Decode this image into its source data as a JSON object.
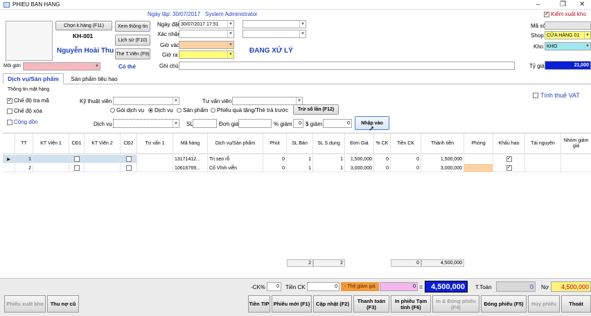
{
  "window": {
    "title": "PHIEU BAN HANG",
    "minimize": "–",
    "restore": "❐",
    "close": "✕"
  },
  "header": {
    "created_label": "Ngày lập: 30/07/2017",
    "user": "System Administrator",
    "status": "ĐANG XỬ LÝ",
    "kiem_xuat_kho": "Kiểm xuất kho"
  },
  "customer": {
    "choose_button": "Chọn k.hàng (F11)",
    "code": "KH-001",
    "name": "Nguyễn Hoài Thu",
    "info_button": "Xem thông tin",
    "history_button": "Lịch sử (F10)",
    "card_button": "Thẻ T.Viên (F9)",
    "has_card": "Có thẻ"
  },
  "booking": {
    "date_label": "Ngày đặt",
    "date_value": "30/07/2017 17:51",
    "confirm_label": "Xác nhận",
    "in_label": "Giờ vào",
    "out_label": "Giờ ra",
    "note_label": "Ghi chú"
  },
  "right_panel": {
    "so_label": "Mã số",
    "shop_label": "Shop",
    "shop_value": "CỬA HÀNG 01",
    "kho_label": "Kho",
    "kho_value": "KHO",
    "rate_label": "Tỷ giá",
    "rate_value": "21,000"
  },
  "referrer": {
    "label": "Môi giới"
  },
  "tabs": [
    {
      "label": "Dịch vụ/Sản phẩm"
    },
    {
      "label": "Sản phẩm tiêu hao"
    }
  ],
  "sale_info": {
    "section": "Thông tin mặt hàng",
    "che_do_tra_ma": "Chế độ tra mã",
    "che_do_xoa": "Chế độ xóa",
    "cong_don": "Cộng dồn",
    "ky_thuat_vien": "Kỹ thuật viên",
    "tu_van_vien": "Tư vấn viên",
    "tinh_thue_vat": "Tính thuế VAT",
    "radios": [
      "Gói dịch vụ",
      "Dịch vụ",
      "Sản phẩm",
      "Phiếu quà tặng/Thẻ trả trước"
    ],
    "tru_so_lan": "Trừ số lần (F12)",
    "dich_vu_label": "Dịch vụ",
    "sl_label": "SL",
    "don_gia_label": "Đơn giá",
    "pct_giam_label": "% giảm",
    "pct_giam_value": "0",
    "usd_giam_label": "$ giảm",
    "usd_giam_value": "0",
    "nhap_vao": "Nhập vào"
  },
  "grid": {
    "columns": [
      "TT",
      "KT Viên 1",
      "CĐ1",
      "KT Viên 2",
      "CĐ2",
      "Tư vấn 1",
      "Mã hàng",
      "Dịch vụ/Sản phẩm",
      "Phút",
      "SL Bán",
      "SL S.dụng",
      "Đơn Giá",
      "% CK",
      "Tiền CK",
      "Thành tiền",
      "Phòng",
      "Khấu hao",
      "Tài nguyên",
      "Nhóm giảm giá"
    ],
    "rows": [
      {
        "tt": "1",
        "ma_hang": "13171412...",
        "ten": "Trị sẹo rỗ",
        "phut": "0",
        "sl_ban": "1",
        "sl_sd": "1",
        "don_gia": "1,500,000",
        "ck": "0",
        "tien_ck": "0",
        "thanh_tien": "1,500,000"
      },
      {
        "tt": "2",
        "ma_hang": "10616769...",
        "ten": "Cố Vĩnh viễn",
        "phut": "0",
        "sl_ban": "1",
        "sl_sd": "1",
        "don_gia": "3,000,000",
        "ck": "0",
        "tien_ck": "0",
        "thanh_tien": "3,000,000"
      }
    ],
    "totals": {
      "sl_ban": "2",
      "sl_sd": "2",
      "tien_ck": "0",
      "thanh_tien": "4,500,000"
    }
  },
  "summary": {
    "ck_pct_label": "-CK%",
    "ck_pct_value": "0",
    "tien_ck_label": "Tiền CK",
    "tien_ck_value": "0",
    "the_giam_gia_label": "- Thẻ giảm giá",
    "the_giam_gia_value": "0",
    "equals": "=",
    "total": "4,500,000",
    "t_toan_label": "T.Toán",
    "t_toan_value": "0",
    "no_label": "Nợ",
    "no_value": "4,500,000"
  },
  "actions": {
    "phieu_xuat_kho": "Phiếu xuất kho",
    "thu_no_cu": "Thu nợ cũ",
    "tien_tip": "Tiền TIP",
    "phieu_moi": "Phiếu mới (F1)",
    "cap_nhat": "Cập nhật (F2)",
    "thanh_toan": "Thanh toán (F3)",
    "in_phieu_tam_tinh": "In phiếu Tạm tính (F6)",
    "in_dong_phieu": "In & Đóng phiếu (F4)",
    "dong_phieu": "Đóng phiếu (F5)",
    "huy_phieu": "Hủy phiếu",
    "thoat": "Thoát"
  },
  "colors": {
    "accent_blue": "#1f3fbf",
    "total_bg": "#0a1fd6",
    "debt_bg": "#fff27a",
    "orange_field": "#fbd1a5",
    "yellow_field": "#ffff7a",
    "pink_field": "#f6b8bf",
    "cyan_field": "#9fe8f0",
    "selected_row": "#cfe0ef",
    "discount_orange": "#f09a3c",
    "discount_pink": "#f2b7ee"
  }
}
